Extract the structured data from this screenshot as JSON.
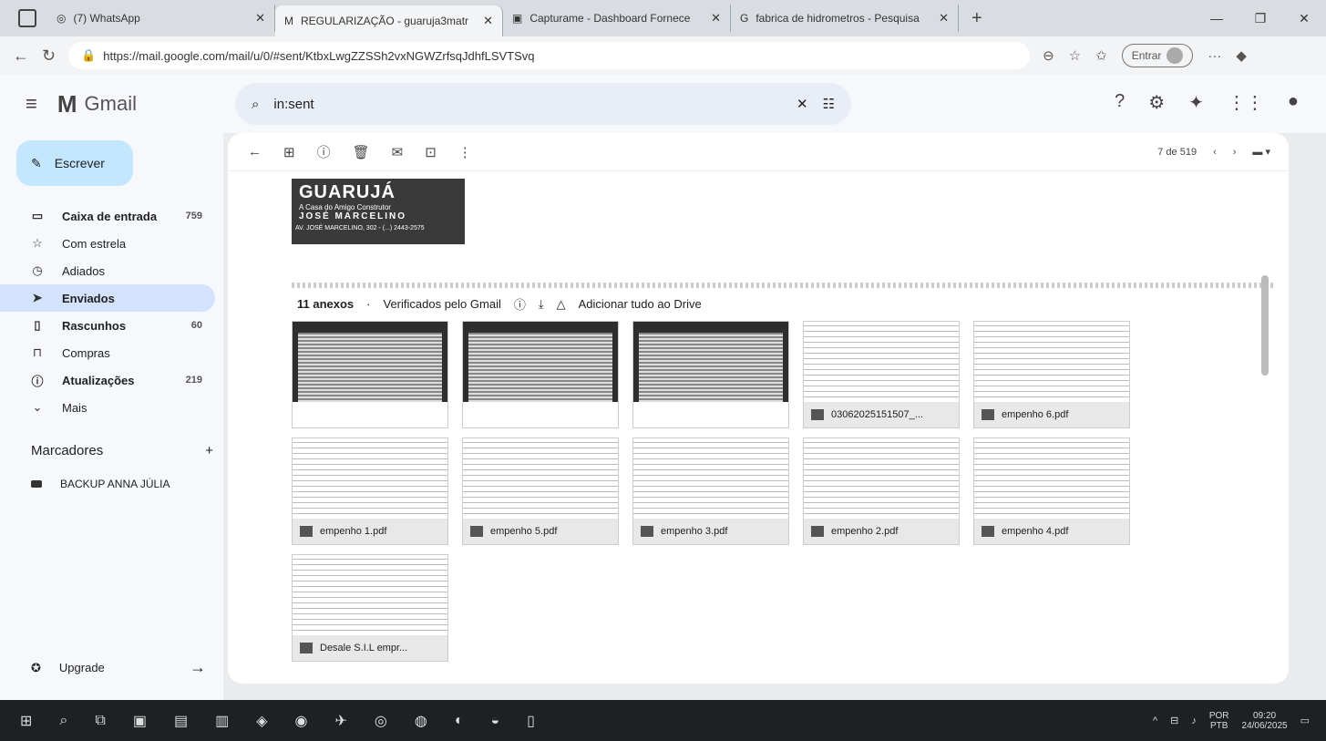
{
  "browser": {
    "tabs": [
      {
        "label": "(7) WhatsApp"
      },
      {
        "label": "REGULARIZAÇÃO - guaruja3matr"
      },
      {
        "label": "Capturame - Dashboard Fornece"
      },
      {
        "label": "fabrica de hidrometros - Pesquisa"
      }
    ],
    "url": "https://mail.google.com/mail/u/0/#sent/KtbxLwgZZSSh2vxNGWZrfsqJdhfLSVTSvq",
    "signin_label": "Entrar"
  },
  "gmail": {
    "brand": "Gmail",
    "search_value": "in:sent",
    "compose_label": "Escrever",
    "nav": [
      {
        "label": "Caixa de entrada",
        "count": "759",
        "icon": "inbox-icon"
      },
      {
        "label": "Com estrela",
        "count": "",
        "icon": "star-icon"
      },
      {
        "label": "Adiados",
        "count": "",
        "icon": "clock-icon"
      },
      {
        "label": "Enviados",
        "count": "",
        "icon": "send-icon"
      },
      {
        "label": "Rascunhos",
        "count": "60",
        "icon": "draft-icon"
      },
      {
        "label": "Compras",
        "count": "",
        "icon": "shopping-icon"
      },
      {
        "label": "Atualizações",
        "count": "219",
        "icon": "info-icon"
      },
      {
        "label": "Mais",
        "count": "",
        "icon": "chevron-down-icon"
      }
    ],
    "labels_title": "Marcadores",
    "labels": [
      {
        "label": "BACKUP ANNA JÚLIA"
      }
    ],
    "upgrade_label": "Upgrade",
    "pager_text": "7 de 519"
  },
  "email": {
    "banner": {
      "title": "GUARUJÁ",
      "tagline": "A Casa do Amigo Construtor",
      "name": "JOSÉ MARCELINO",
      "footer": "AV. JOSÉ MARCELINO, 302 - (...) 2443-2575"
    },
    "attachments_count": "11 anexos",
    "verified_label": "Verificados pelo Gmail",
    "add_drive_label": "Adicionar tudo ao Drive",
    "attachments": [
      {
        "name": "",
        "kind": "dark"
      },
      {
        "name": "",
        "kind": "dark"
      },
      {
        "name": "",
        "kind": "dark"
      },
      {
        "name": "03062025151507_...",
        "kind": "doc"
      },
      {
        "name": "empenho 6.pdf",
        "kind": "doc"
      },
      {
        "name": "empenho 1.pdf",
        "kind": "doc"
      },
      {
        "name": "empenho 5.pdf",
        "kind": "doc"
      },
      {
        "name": "empenho 3.pdf",
        "kind": "doc"
      },
      {
        "name": "empenho 2.pdf",
        "kind": "doc"
      },
      {
        "name": "empenho 4.pdf",
        "kind": "doc"
      },
      {
        "name": "Desale S.I.L empr...",
        "kind": "doc"
      }
    ]
  },
  "taskbar": {
    "lang": "POR",
    "lang2": "PTB",
    "time": "09:20",
    "date": "24/06/2025"
  }
}
